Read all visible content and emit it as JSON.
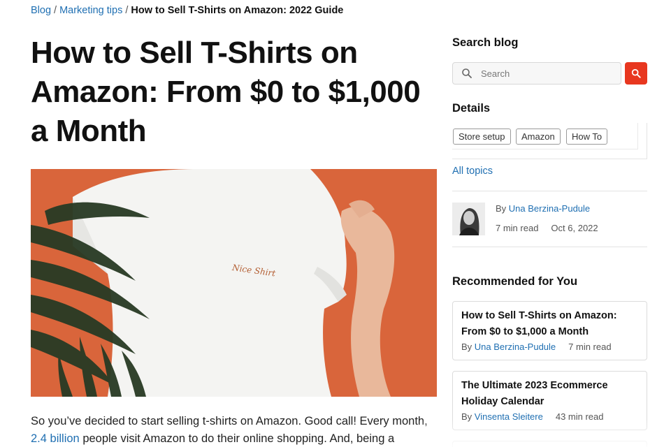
{
  "breadcrumb": {
    "items": [
      "Blog",
      "Marketing tips"
    ],
    "separator": "/",
    "current": "How to Sell T-Shirts on Amazon: 2022 Guide"
  },
  "article": {
    "title": "How to Sell T-Shirts on Amazon: From $0 to $1,000 a Month",
    "intro_before": "So you’ve decided to start selling t-shirts on Amazon. Good call! Every month,",
    "intro_link": "2.4 billion",
    "intro_after": "people visit Amazon to do their online shopping. And, being a",
    "hero_shirt_text": "Nice Shirt"
  },
  "sidebar": {
    "search_heading": "Search blog",
    "search_placeholder": "Search",
    "details_heading": "Details",
    "tags": [
      "Store setup",
      "Amazon",
      "How To"
    ],
    "all_topics": "All topics",
    "author_prefix": "By",
    "author_name": "Una Berzina-Pudule",
    "read_time": "7 min read",
    "date": "Oct 6, 2022",
    "recommended_heading": "Recommended for You",
    "recommended": [
      {
        "title": "How to Sell T-Shirts on Amazon: From $0 to $1,000 a Month",
        "by": "By",
        "author": "Una Berzina-Pudule",
        "read_time": "7 min read"
      },
      {
        "title": "The Ultimate 2023 Ecommerce Holiday Calendar",
        "by": "By",
        "author": "Vinsenta Sleitere",
        "read_time": "43 min read"
      }
    ]
  },
  "colors": {
    "link": "#1f6fb2",
    "accent_search": "#e8371f",
    "hero_background": "#d9653b"
  },
  "icons": {
    "search_field": "search-icon",
    "search_button": "search-icon"
  }
}
